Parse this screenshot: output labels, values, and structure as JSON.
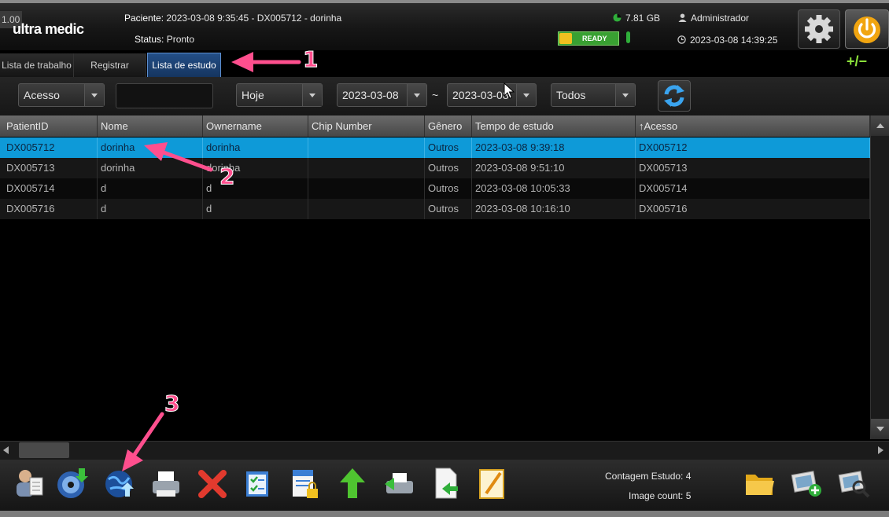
{
  "header": {
    "version": "1.00",
    "logo": "ultra medic",
    "patient_label": "Paciente:",
    "patient_value": "2023-03-08 9:35:45 - DX005712 - dorinha",
    "status_label": "Status:",
    "status_value": "Pronto",
    "disk_free": "7.81 GB",
    "user": "Administrador",
    "ready": "READY",
    "datetime": "2023-03-08 14:39:25"
  },
  "tabs": [
    {
      "label": "Lista de trabalho",
      "active": false
    },
    {
      "label": "Registrar",
      "active": false
    },
    {
      "label": "Lista de estudo",
      "active": true
    }
  ],
  "plus_minus": "+/−",
  "filters": {
    "access": "Acesso",
    "search": "",
    "period": "Hoje",
    "date_from": "2023-03-08",
    "range_sep": "~",
    "date_to": "2023-03-08",
    "modality": "Todos"
  },
  "table": {
    "columns": [
      "PatientID",
      "Nome",
      "Ownername",
      "Chip Number",
      "Gênero",
      "Tempo de estudo",
      "↑Acesso"
    ],
    "rows": [
      [
        "DX005712",
        "dorinha",
        "dorinha",
        "",
        "Outros",
        "2023-03-08 9:39:18",
        "DX005712"
      ],
      [
        "DX005713",
        "dorinha",
        "dorinha",
        "",
        "Outros",
        "2023-03-08 9:51:10",
        "DX005713"
      ],
      [
        "DX005714",
        "d",
        "d",
        "",
        "Outros",
        "2023-03-08 10:05:33",
        "DX005714"
      ],
      [
        "DX005716",
        "d",
        "d",
        "",
        "Outros",
        "2023-03-08 10:16:10",
        "DX005716"
      ]
    ],
    "selected_row": 0
  },
  "toolbar": {
    "tools": [
      "patient-info-icon",
      "cd-burn-icon",
      "globe-upload-icon",
      "printer-icon",
      "delete-icon",
      "edit-list-icon",
      "lock-document-icon",
      "upload-arrow-icon",
      "film-printer-icon",
      "export-document-icon",
      "report-edit-icon"
    ],
    "study_count_label": "Contagem Estudo:",
    "study_count": "4",
    "image_count_label": "Image count:",
    "image_count": "5"
  },
  "annotations": [
    "1",
    "2",
    "3"
  ],
  "colors": {
    "selected_row": "#0e9ad8",
    "active_tab": "#1d447a",
    "ready_green": "#39a032",
    "annotation_pink": "#ff4f8e"
  }
}
